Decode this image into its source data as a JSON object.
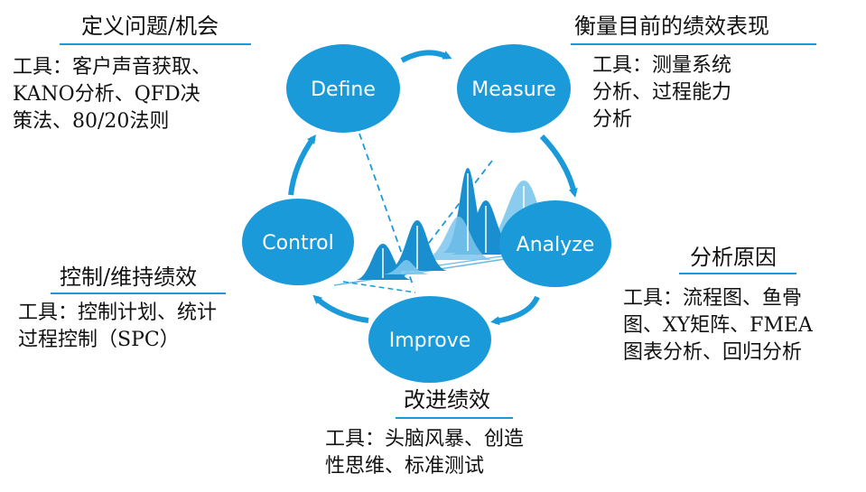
{
  "colors": {
    "circle": "#1a9ad8",
    "arrow": "#1a9ad8",
    "underline": "#1a9ad8",
    "curve_dark": "#1a8fd0",
    "curve_light": "#7cc6ec",
    "text": "#111111"
  },
  "phases": {
    "define": "Define",
    "measure": "Measure",
    "analyze": "Analyze",
    "improve": "Improve",
    "control": "Control"
  },
  "sections": {
    "define": {
      "heading": "定义问题/机会",
      "tools": [
        "工具：客户声音获取、",
        "KANO分析、QFD决",
        "策法、80/20法则"
      ]
    },
    "measure": {
      "heading": "衡量目前的绩效表现",
      "tools": [
        "工具：测量系统",
        "分析、过程能力",
        "分析"
      ]
    },
    "analyze": {
      "heading": "分析原因",
      "tools": [
        "工具：流程图、鱼骨",
        "图、XY矩阵、FMEA",
        "图表分析、回归分析"
      ]
    },
    "improve": {
      "heading": "改进绩效",
      "tools": [
        "工具：头脑风暴、创造",
        "性思维、标准测试"
      ]
    },
    "control": {
      "heading": "控制/维持绩效",
      "tools": [
        "工具：控制计划、统计",
        "过程控制（SPC）"
      ]
    }
  },
  "icons": {
    "cycle_arrows": "curved-arrow-icon",
    "distribution": "bell-curve-icon"
  }
}
